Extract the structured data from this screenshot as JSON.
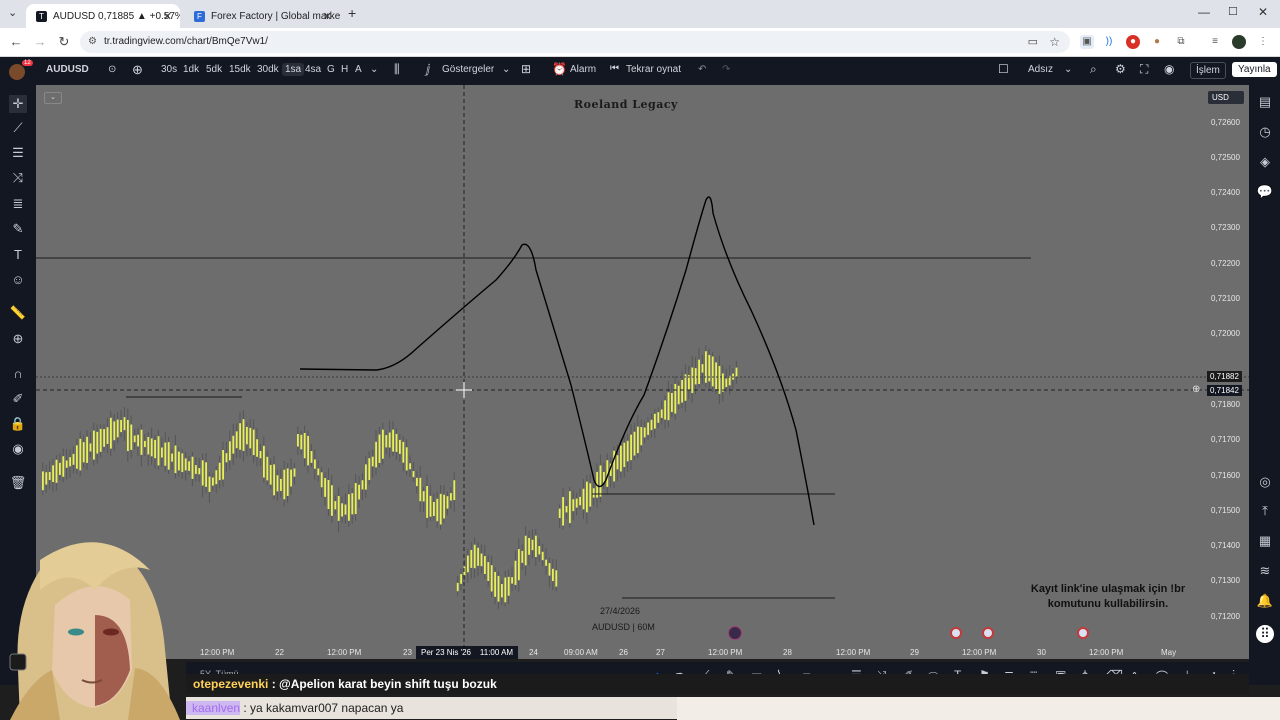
{
  "browser": {
    "tabs": [
      {
        "title": "AUDUSD 0,71885 ▲ +0.57% Ad",
        "active": true
      },
      {
        "title": "Forex Factory | Global markets",
        "active": false
      }
    ],
    "url": "tr.tradingview.com/chart/BmQe7Vw1/",
    "new_tab": "+"
  },
  "toolbar": {
    "symbol": "AUDUSD",
    "intervals": [
      "30s",
      "1dk",
      "5dk",
      "15dk",
      "30dk",
      "1sa",
      "4sa",
      "G",
      "H",
      "A"
    ],
    "selected_interval": "1sa",
    "indicators": "Göstergeler",
    "alarm": "Alarm",
    "replay": "Tekrar oynat",
    "layout_name": "Adsız",
    "trade": "İşlem",
    "publish": "Yayınla",
    "notif_badge": "12"
  },
  "chart": {
    "watermark": "Roeland Legacy",
    "currency": "USD",
    "price_labels": [
      "0,72600",
      "0,72500",
      "0,72400",
      "0,72300",
      "0,72200",
      "0,72100",
      "0,72000",
      "0,71800",
      "0,71700",
      "0,71600",
      "0,71500",
      "0,71400",
      "0,71300",
      "0,71200"
    ],
    "last_price": "0,71882",
    "cursor_price": "0,71842",
    "time_labels": [
      "12:00 PM",
      "22",
      "12:00 PM",
      "23",
      "24",
      "09:00 AM",
      "26",
      "27",
      "12:00 PM",
      "28",
      "12:00 PM",
      "29",
      "12:00 PM",
      "30",
      "12:00 PM",
      "May"
    ],
    "cursor_time": "Per 23 Nis '26    11:00 AM",
    "date_note": "27/4/2026",
    "symbol_note": "AUDUSD | 60M",
    "overlay_text": "Kayıt link'ine ulaşmak için !br komutunu kullabilirsin.",
    "bottom_range": "5Y  Tümü"
  },
  "chat": {
    "msg1_user": "otepezevenki",
    "msg1_text": " : @Apelion karat beyin shift tuşu bozuk",
    "msg2_user": "kaanlven",
    "msg2_text": " : ya kakamvar007 napacan ya"
  },
  "colors": {
    "chart_bg": "#6d6d6d",
    "candles": "#e8f056",
    "toolbar_bg": "#131722",
    "chat_user1": "#ffd25a",
    "chat_user2": "#a56cf0"
  }
}
